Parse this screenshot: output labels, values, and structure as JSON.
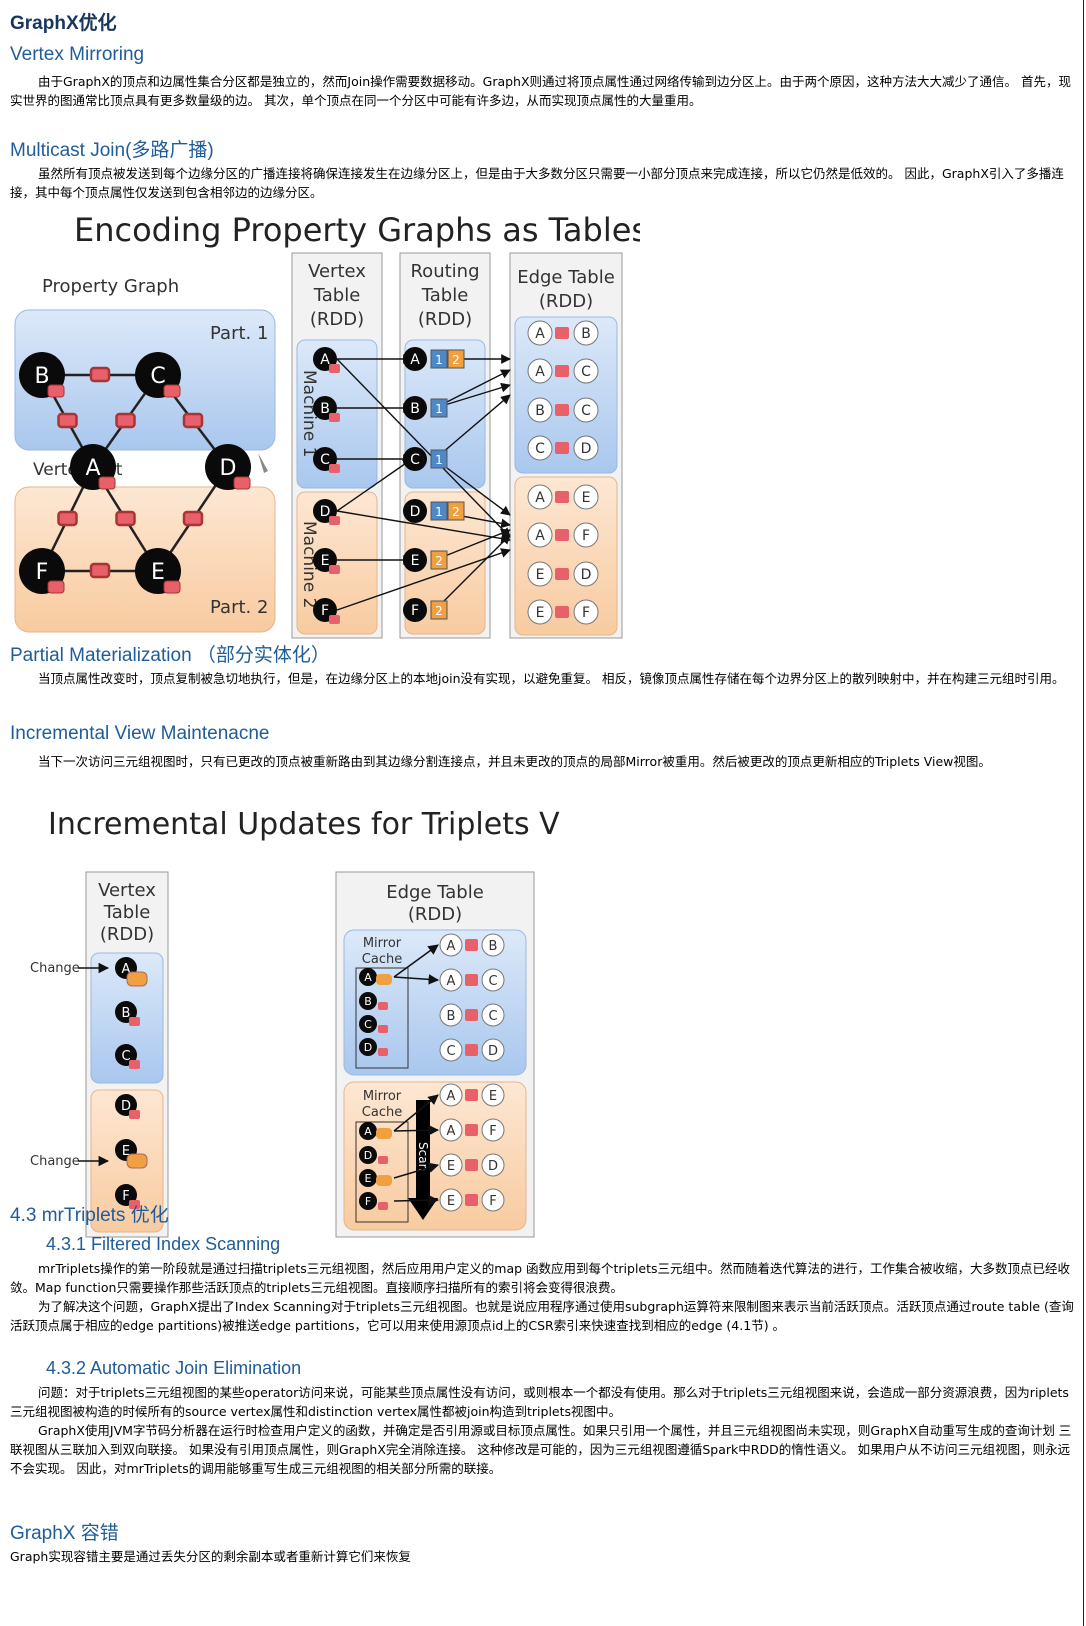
{
  "sections": {
    "title": "GraphX优化",
    "vertex_mirroring": {
      "heading": "Vertex Mirroring",
      "text": "由于GraphX的顶点和边属性集合分区都是独立的，然而Join操作需要数据移动。GraphX则通过将顶点属性通过网络传输到边分区上。由于两个原因，这种方法大大减少了通信。 首先，现实世界的图通常比顶点具有更多数量级的边。 其次，单个顶点在同一个分区中可能有许多边，从而实现顶点属性的大量重用。"
    },
    "multicast_join": {
      "heading": "Multicast Join(多路广播)",
      "text": "虽然所有顶点被发送到每个边缘分区的广播连接将确保连接发生在边缘分区上，但是由于大多数分区只需要一小部分顶点来完成连接，所以它仍然是低效的。 因此，GraphX引入了多播连接，其中每个顶点属性仅发送到包含相邻边的边缘分区。"
    },
    "partial_materialization": {
      "heading": "Partial Materialization （部分实体化）",
      "text": "当顶点属性改变时，顶点复制被急切地执行，但是，在边缘分区上的本地join没有实现，以避免重复。 相反，镜像顶点属性存储在每个边界分区上的散列映射中，并在构建三元组时引用。"
    },
    "incremental_view": {
      "heading": "Incremental View Maintenacne",
      "text": "当下一次访问三元组视图时，只有已更改的顶点被重新路由到其边缘分割连接点，并且未更改的顶点的局部Mirror被重用。然后被更改的顶点更新相应的Triplets View视图。"
    },
    "mrtriplets": {
      "heading": "4.3 mrTriplets 优化",
      "filtered": {
        "heading": "4.3.1 Filtered Index Scanning",
        "text1": "mrTriplets操作的第一阶段就是通过扫描triplets三元组视图，然后应用用户定义的map 函数应用到每个triplets三元组中。然而随着迭代算法的进行，工作集合被收缩，大多数顶点已经收敛。Map function只需要操作那些活跃顶点的triplets三元组视图。直接顺序扫描所有的索引将会变得很浪费。",
        "text2": "为了解决这个问题，GraphX提出了Index Scanning对于triplets三元组视图。也就是说应用程序通过使用subgraph运算符来限制图来表示当前活跃顶点。活跃顶点通过route table (查询活跃顶点属于相应的edge partitions)被推送edge partitions，它可以用来使用源顶点id上的CSR索引来快速查找到相应的edge (4.1节) 。"
      },
      "automatic": {
        "heading": "4.3.2 Automatic Join Elimination",
        "text1": "问题：对于triplets三元组视图的某些operator访问来说，可能某些顶点属性没有访问，或则根本一个都没有使用。那么对于triplets三元组视图来说，会造成一部分资源浪费，因为riplets三元组视图被构造的时候所有的source vertex属性和distinction vertex属性都被join构造到triplets视图中。",
        "text2": "GraphX使用JVM字节码分析器在运行时检查用户定义的函数，并确定是否引用源或目标顶点属性。如果只引用一个属性，并且三元组视图尚未实现，则GraphX自动重写生成的查询计划 三联视图从三联加入到双向联接。 如果没有引用顶点属性，则GraphX完全消除连接。 这种修改是可能的，因为三元组视图遵循Spark中RDD的惰性语义。 如果用户从不访问三元组视图，则永远不会实现。 因此，对mrTriplets的调用能够重写生成三元组视图的相关部分所需的联接。"
      }
    },
    "fault_tolerance": {
      "heading": "GraphX 容错",
      "text": "Graph实现容错主要是通过丢失分区的剩余副本或者重新计算它们来恢复"
    }
  },
  "figure1": {
    "title": "Encoding Property Graphs as Tables",
    "property_graph_label": "Property Graph",
    "part1": "Part. 1",
    "part2": "Part. 2",
    "vertex_cut": "Vertex Cut",
    "vertex_table": [
      "Vertex",
      "Table",
      "(RDD)"
    ],
    "routing_table": [
      "Routing",
      "Table",
      "(RDD)"
    ],
    "edge_table": [
      "Edge Table",
      "(RDD)"
    ],
    "machine1": "Machine 1",
    "machine2": "Machine 2",
    "graph_nodes": [
      "B",
      "C",
      "A",
      "D",
      "F",
      "E"
    ],
    "vertices": [
      "A",
      "B",
      "C",
      "D",
      "E",
      "F"
    ],
    "routing": [
      {
        "v": "A",
        "parts": [
          "1",
          "2"
        ]
      },
      {
        "v": "B",
        "parts": [
          "1"
        ]
      },
      {
        "v": "C",
        "parts": [
          "1"
        ]
      },
      {
        "v": "D",
        "parts": [
          "1",
          "2"
        ]
      },
      {
        "v": "E",
        "parts": [
          "2"
        ]
      },
      {
        "v": "F",
        "parts": [
          "2"
        ]
      }
    ],
    "edges_part1": [
      [
        "A",
        "B"
      ],
      [
        "A",
        "C"
      ],
      [
        "B",
        "C"
      ],
      [
        "C",
        "D"
      ]
    ],
    "edges_part2": [
      [
        "A",
        "E"
      ],
      [
        "A",
        "F"
      ],
      [
        "E",
        "D"
      ],
      [
        "E",
        "F"
      ]
    ]
  },
  "figure2": {
    "title": "Incremental Updates for Triplets View",
    "vertex_table": [
      "Vertex",
      "Table",
      "(RDD)"
    ],
    "edge_table": [
      "Edge Table",
      "(RDD)"
    ],
    "change": "Change",
    "mirror_cache": [
      "Mirror",
      "Cache"
    ],
    "scan": "Scan",
    "vertices": [
      "A",
      "B",
      "C",
      "D",
      "E",
      "F"
    ],
    "cache1": [
      "A",
      "B",
      "C",
      "D"
    ],
    "cache2": [
      "A",
      "D",
      "E",
      "F"
    ],
    "edges_part1": [
      [
        "A",
        "B"
      ],
      [
        "A",
        "C"
      ],
      [
        "B",
        "C"
      ],
      [
        "C",
        "D"
      ]
    ],
    "edges_part2": [
      [
        "A",
        "E"
      ],
      [
        "A",
        "F"
      ],
      [
        "E",
        "D"
      ],
      [
        "E",
        "F"
      ]
    ]
  },
  "colors": {
    "heading": "#1f5c99",
    "blue_panel": "#c5daf3",
    "orange_panel": "#fbdcc0",
    "edge_red": "#e8606a",
    "routing_blue": "#4f88c6",
    "routing_orange": "#f0a040"
  }
}
